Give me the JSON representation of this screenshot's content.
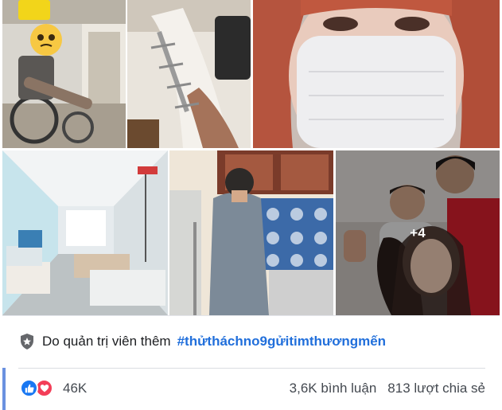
{
  "photos": [
    {
      "id": "photo-wheelchair",
      "alt": "Người ngồi xe lăn với chân bị thương"
    },
    {
      "id": "photo-leg-fixator",
      "alt": "Chân bó bột với khung cố định"
    },
    {
      "id": "photo-masked-face",
      "alt": "Người đeo khẩu trang"
    },
    {
      "id": "photo-hospital-ward",
      "alt": "Hành lang bệnh viện với giường bệnh"
    },
    {
      "id": "photo-kitchen",
      "alt": "Người đàn ông chống nạng trong bếp"
    },
    {
      "id": "photo-family",
      "alt": "Gia đình chụp ảnh",
      "more_label": "+4"
    }
  ],
  "admin_note": {
    "text": "Do quản trị viên thêm",
    "hashtag": "#thửtháchno9gửitimthươngmến"
  },
  "stats": {
    "reactions_count": "46K",
    "comments": "3,6K bình luận",
    "shares": "813 lượt chia sẻ"
  },
  "colors": {
    "like": "#1877f2",
    "love": "#f33e58",
    "hashtag": "#216fdb",
    "accent_bar": "#6a91e0"
  }
}
